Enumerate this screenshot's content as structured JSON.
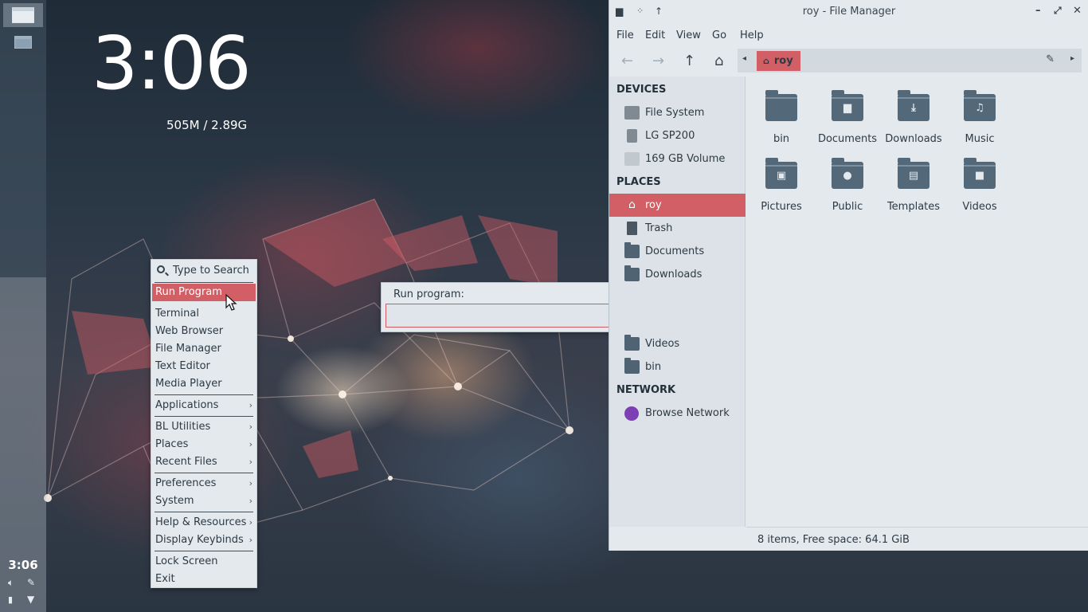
{
  "desktop": {
    "clock": "3:06",
    "memory": "505M / 2.89G"
  },
  "panel": {
    "clock": "3:06",
    "workspaces": [
      "workspace-1",
      "workspace-2"
    ]
  },
  "root_menu": {
    "search_label": "Type to Search",
    "items": [
      {
        "label": "Run Program",
        "selected": true
      },
      {
        "label": "Terminal"
      },
      {
        "label": "Web Browser"
      },
      {
        "label": "File Manager"
      },
      {
        "label": "Text Editor"
      },
      {
        "label": "Media Player"
      },
      {
        "label": "Applications",
        "submenu": true
      },
      {
        "label": "BL Utilities",
        "submenu": true
      },
      {
        "label": "Places",
        "submenu": true
      },
      {
        "label": "Recent Files",
        "submenu": true
      },
      {
        "label": "Preferences",
        "submenu": true
      },
      {
        "label": "System",
        "submenu": true
      },
      {
        "label": "Help & Resources",
        "submenu": true
      },
      {
        "label": "Display Keybinds",
        "submenu": true
      },
      {
        "label": "Lock Screen"
      },
      {
        "label": "Exit"
      }
    ],
    "submenu_arrow": "›"
  },
  "run_dialog": {
    "label": "Run program:",
    "value": ""
  },
  "file_manager": {
    "title": "roy - File Manager",
    "menus": [
      "File",
      "Edit",
      "View",
      "Go",
      "Help"
    ],
    "path_crumb": "roy",
    "sidebar": {
      "devices_header": "DEVICES",
      "devices": [
        "File System",
        "LG SP200",
        "169 GB Volume"
      ],
      "places_header": "PLACES",
      "places": [
        "roy",
        "Trash",
        "Documents",
        "Downloads",
        "Videos",
        "bin"
      ],
      "network_header": "NETWORK",
      "network": [
        "Browse Network"
      ]
    },
    "items": [
      {
        "name": "bin",
        "icon": "folder-icon",
        "emblem": ""
      },
      {
        "name": "Documents",
        "icon": "documents-folder-icon",
        "emblem": "▆"
      },
      {
        "name": "Downloads",
        "icon": "downloads-folder-icon",
        "emblem": "⤓"
      },
      {
        "name": "Music",
        "icon": "music-folder-icon",
        "emblem": "♫"
      },
      {
        "name": "Pictures",
        "icon": "pictures-folder-icon",
        "emblem": "▣"
      },
      {
        "name": "Public",
        "icon": "public-folder-icon",
        "emblem": "●"
      },
      {
        "name": "Templates",
        "icon": "templates-folder-icon",
        "emblem": "▤"
      },
      {
        "name": "Videos",
        "icon": "videos-folder-icon",
        "emblem": "■"
      }
    ],
    "status": "8 items, Free space: 64.1 GiB"
  },
  "colors": {
    "accent": "#d35f66",
    "window_bg": "#e4e9ed",
    "sidebar_bg": "#dce2e7",
    "folder": "#536878",
    "network_icon": "#7c3fb4"
  }
}
